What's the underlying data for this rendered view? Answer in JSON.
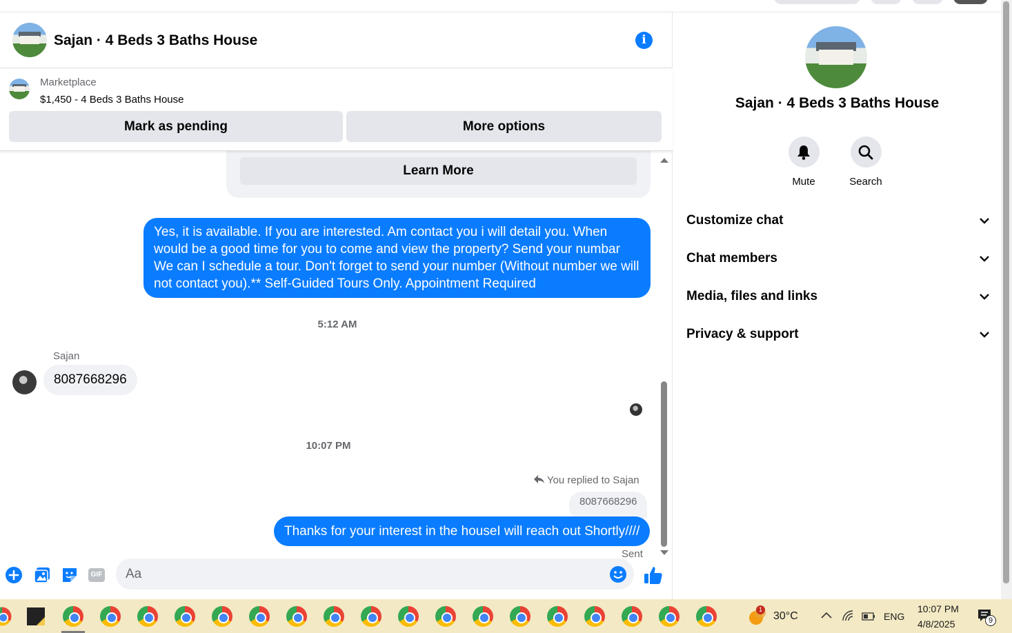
{
  "chat": {
    "title": "Sajan · 4 Beds 3 Baths House",
    "listing_source": "Marketplace",
    "listing_price_title": "$1,450 - 4 Beds 3 Baths House",
    "mark_pending_label": "Mark as pending",
    "more_options_label": "More options",
    "learn_more_label": "Learn More"
  },
  "messages": {
    "outgoing_1": "Yes, it is available. If you are interested.  Am contact you i will detail you.  When would be a good time for you to come and view the property? Send your numbar  We can I schedule a tour.  Don't forget to send your number (Without number we will not contact you).** Self-Guided Tours Only. Appointment Required",
    "time_1": "5:12 AM",
    "sender_name": "Sajan",
    "incoming_1": "8087668296",
    "time_2": "10:07 PM",
    "replied_label": "You replied to Sajan",
    "quoted_text": "8087668296",
    "outgoing_2": "Thanks for your interest in the houseI will reach out Shortly////",
    "status": "Sent"
  },
  "composer": {
    "placeholder": "Aa",
    "icons": [
      "plus-icon",
      "photo-icon",
      "sticker-icon",
      "gif-icon",
      "emoji-icon",
      "thumbs-up-icon"
    ],
    "gif_label": "GIF"
  },
  "info_panel": {
    "title": "Sajan · 4 Beds 3 Baths House",
    "mute_label": "Mute",
    "search_label": "Search",
    "sections": [
      "Customize chat",
      "Chat members",
      "Media, files and links",
      "Privacy & support"
    ]
  },
  "taskbar": {
    "temperature": "30°C",
    "weather_badge": "1",
    "language": "ENG",
    "time": "10:07 PM",
    "date": "4/8/2025",
    "notification_count": "9"
  },
  "colors": {
    "accent": "#0a7cff",
    "bubble_in": "#f0f2f5",
    "button_gray": "#e4e6eb",
    "taskbar": "#f3e9c4"
  }
}
